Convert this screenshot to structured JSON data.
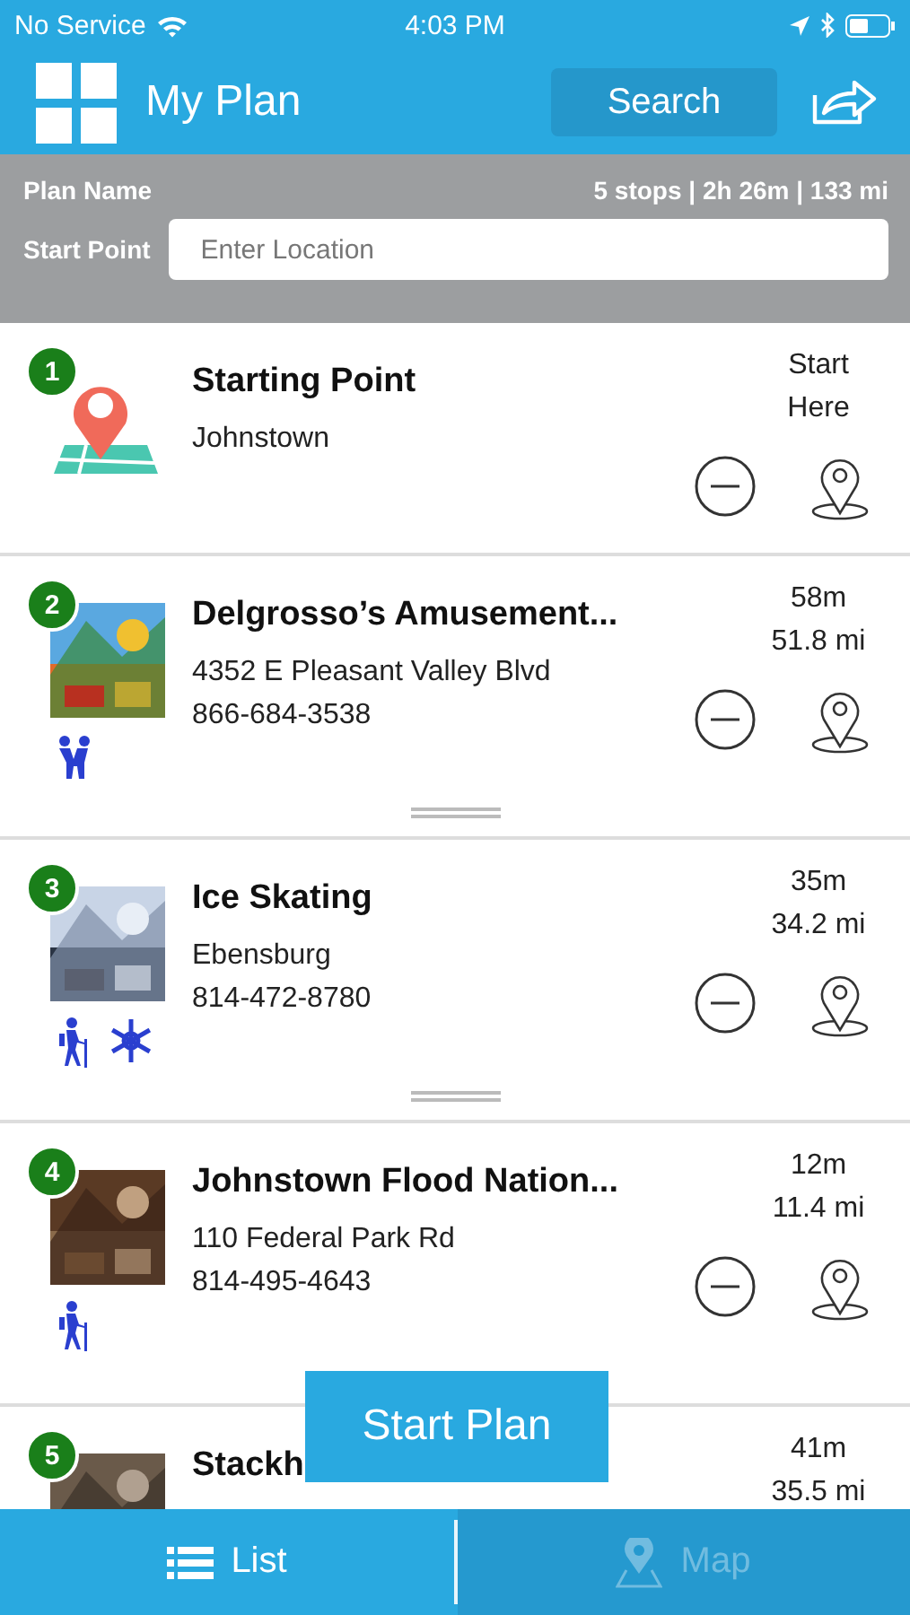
{
  "status_bar": {
    "carrier": "No Service",
    "time": "4:03 PM"
  },
  "header": {
    "title": "My Plan",
    "search_button": "Search"
  },
  "plan": {
    "name_label": "Plan Name",
    "summary": "5 stops | 2h 26m | 133 mi",
    "start_label": "Start Point",
    "start_placeholder": "Enter Location"
  },
  "stops": [
    {
      "number": "1",
      "kind": "start",
      "title": "Starting Point",
      "lines": [
        "Johnstown"
      ],
      "time": "Start",
      "distance": "Here",
      "draggable": false
    },
    {
      "number": "2",
      "kind": "place",
      "title": "Delgrosso’s Amusement...",
      "lines": [
        "4352 E Pleasant Valley Blvd",
        "866-684-3538"
      ],
      "time": "58m",
      "distance": "51.8 mi",
      "amenities": [
        {
          "kind": "family"
        }
      ],
      "draggable": true
    },
    {
      "number": "3",
      "kind": "place",
      "title": "Ice Skating",
      "lines": [
        "Ebensburg",
        "814-472-8780"
      ],
      "time": "35m",
      "distance": "34.2 mi",
      "amenities": [
        {
          "kind": "hiking"
        },
        {
          "kind": "snow"
        }
      ],
      "draggable": true
    },
    {
      "number": "4",
      "kind": "place",
      "title": "Johnstown Flood Nation...",
      "lines": [
        "110 Federal Park Rd",
        "814-495-4643"
      ],
      "time": "12m",
      "distance": "11.4 mi",
      "amenities": [
        {
          "kind": "hiking"
        }
      ],
      "draggable": false
    },
    {
      "number": "5",
      "kind": "place",
      "title": "Stackh",
      "time": "41m",
      "distance": "35.5 mi",
      "draggable": false
    }
  ],
  "start_plan_button": "Start Plan",
  "tabs": [
    {
      "label": "List",
      "selected": true
    },
    {
      "label": "Map",
      "selected": false
    }
  ]
}
